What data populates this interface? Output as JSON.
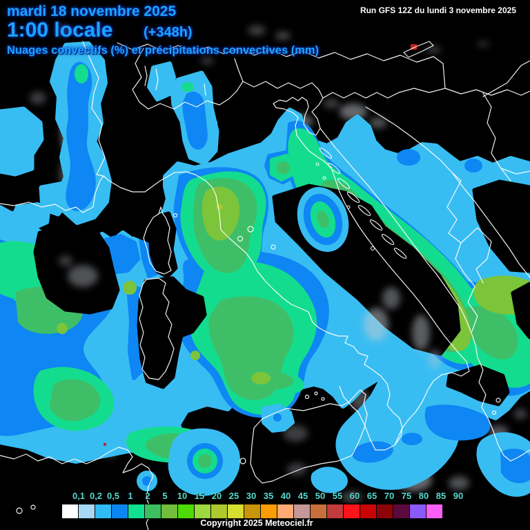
{
  "header": {
    "date": "mardi 18 novembre 2025",
    "time": "1:00 locale",
    "offset": "(+348h)",
    "subtitle": "Nuages convectifs (%) et précipitations convectives (mm)",
    "run_info": "Run GFS 12Z du lundi 3 novembre 2025",
    "text_color": "#1EA2FF"
  },
  "legend": {
    "values": [
      "0,1",
      "0,2",
      "0,5",
      "1",
      "2",
      "5",
      "10",
      "15",
      "20",
      "25",
      "30",
      "35",
      "40",
      "45",
      "50",
      "55",
      "60",
      "65",
      "70",
      "75",
      "80",
      "85",
      "90"
    ],
    "colors": [
      "#FFFFFF",
      "#A6D7F5",
      "#30BCF2",
      "#0B86F0",
      "#10E091",
      "#3DBE5F",
      "#74BE3C",
      "#4EDB05",
      "#9ED83F",
      "#AFC92D",
      "#D6DE30",
      "#C8960B",
      "#FA9D05",
      "#FFAA72",
      "#C59799",
      "#C8703C",
      "#C33C3C",
      "#FB1418",
      "#C90407",
      "#8C0408",
      "#5C0A3E",
      "#8A5BF8",
      "#FA5FF5"
    ],
    "label_color": "#57D9CF",
    "copyright": "Copyright 2025 Meteociel.fr"
  },
  "map": {
    "colors": {
      "background": "#000000",
      "coastline": "#FFFFFF",
      "cloud": "#C9CED4",
      "precip_cyan": "#38BDF2",
      "precip_blue": "#0E86F3",
      "precip_spring": "#14DC8E",
      "precip_green": "#3FBE68",
      "precip_ygreen": "#7CC43A",
      "precip_olive": "#AFC92D",
      "marker_red": "#C42222"
    },
    "run_text_color": "#FFFFFF"
  }
}
